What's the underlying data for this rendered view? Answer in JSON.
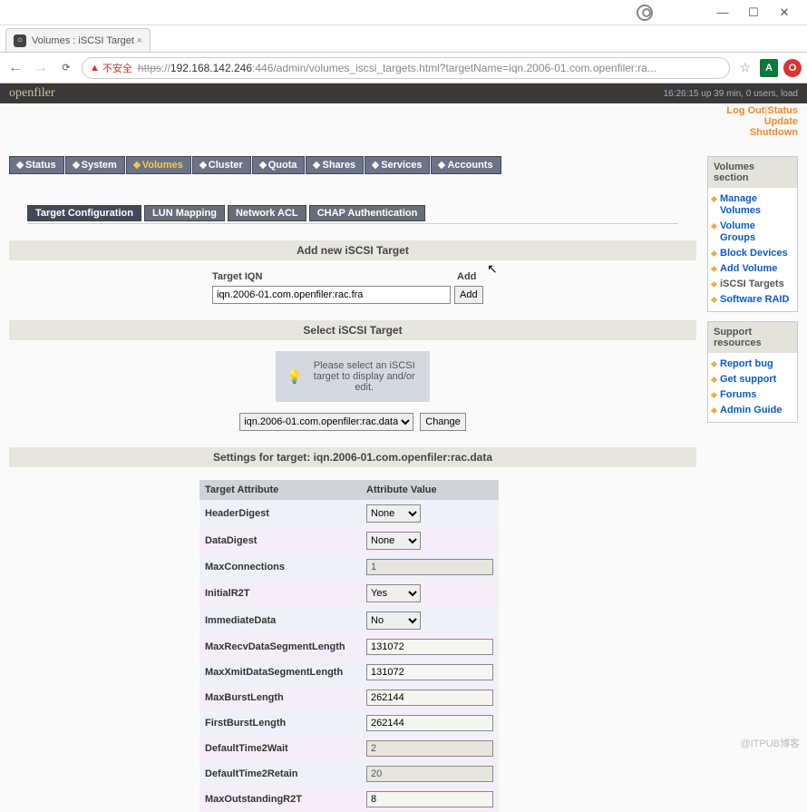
{
  "browser": {
    "tab_title": "Volumes : iSCSI Target",
    "insecure_label": "不安全",
    "url_https": "https",
    "url_sep": "://",
    "url_host": "192.168.142.246",
    "url_path": ":446/admin/volumes_iscsi_targets.html?targetName=iqn.2006-01.com.openfiler:ra...",
    "win_min": "—",
    "win_max": "☐",
    "win_close": "✕",
    "ext_a": "A",
    "ext_o": "O"
  },
  "header": {
    "logo": "openfiler",
    "uptime": "16:26:15 up 39 min, 0 users, load",
    "links": {
      "logout": "Log Out",
      "status": "Status",
      "update": "Update",
      "shutdown": "Shutdown"
    }
  },
  "topnav": {
    "status": "Status",
    "system": "System",
    "volumes": "Volumes",
    "cluster": "Cluster",
    "quota": "Quota",
    "shares": "Shares",
    "services": "Services",
    "accounts": "Accounts"
  },
  "subtabs": {
    "targetconf": "Target Configuration",
    "lun": "LUN Mapping",
    "acl": "Network ACL",
    "chap": "CHAP Authentication"
  },
  "sections": {
    "add_title": "Add new iSCSI Target",
    "iqn_label": "Target IQN",
    "add_label": "Add",
    "iqn_value": "iqn.2006-01.com.openfiler:rac.fra",
    "add_btn": "Add",
    "select_title": "Select iSCSI Target",
    "hint": "Please select an iSCSI target to display and/or edit.",
    "select_value": "iqn.2006-01.com.openfiler:rac.data",
    "change_btn": "Change",
    "settings_title": "Settings for target: iqn.2006-01.com.openfiler:rac.data",
    "col_attr": "Target Attribute",
    "col_val": "Attribute Value"
  },
  "attrs": [
    {
      "name": "HeaderDigest",
      "type": "select",
      "value": "None"
    },
    {
      "name": "DataDigest",
      "type": "select",
      "value": "None"
    },
    {
      "name": "MaxConnections",
      "type": "ro",
      "value": "1"
    },
    {
      "name": "InitialR2T",
      "type": "select",
      "value": "Yes"
    },
    {
      "name": "ImmediateData",
      "type": "select",
      "value": "No"
    },
    {
      "name": "MaxRecvDataSegmentLength",
      "type": "text",
      "value": "131072"
    },
    {
      "name": "MaxXmitDataSegmentLength",
      "type": "text",
      "value": "131072"
    },
    {
      "name": "MaxBurstLength",
      "type": "text",
      "value": "262144"
    },
    {
      "name": "FirstBurstLength",
      "type": "text",
      "value": "262144"
    },
    {
      "name": "DefaultTime2Wait",
      "type": "ro",
      "value": "2"
    },
    {
      "name": "DefaultTime2Retain",
      "type": "ro",
      "value": "20"
    },
    {
      "name": "MaxOutstandingR2T",
      "type": "text",
      "value": "8"
    }
  ],
  "sidebar": {
    "vol_title": "Volumes section",
    "vol_links": [
      "Manage Volumes",
      "Volume Groups",
      "Block Devices",
      "Add Volume",
      "iSCSI Targets",
      "Software RAID"
    ],
    "sup_title": "Support resources",
    "sup_links": [
      "Report bug",
      "Get support",
      "Forums",
      "Admin Guide"
    ]
  },
  "watermark": "@ITPUB博客"
}
